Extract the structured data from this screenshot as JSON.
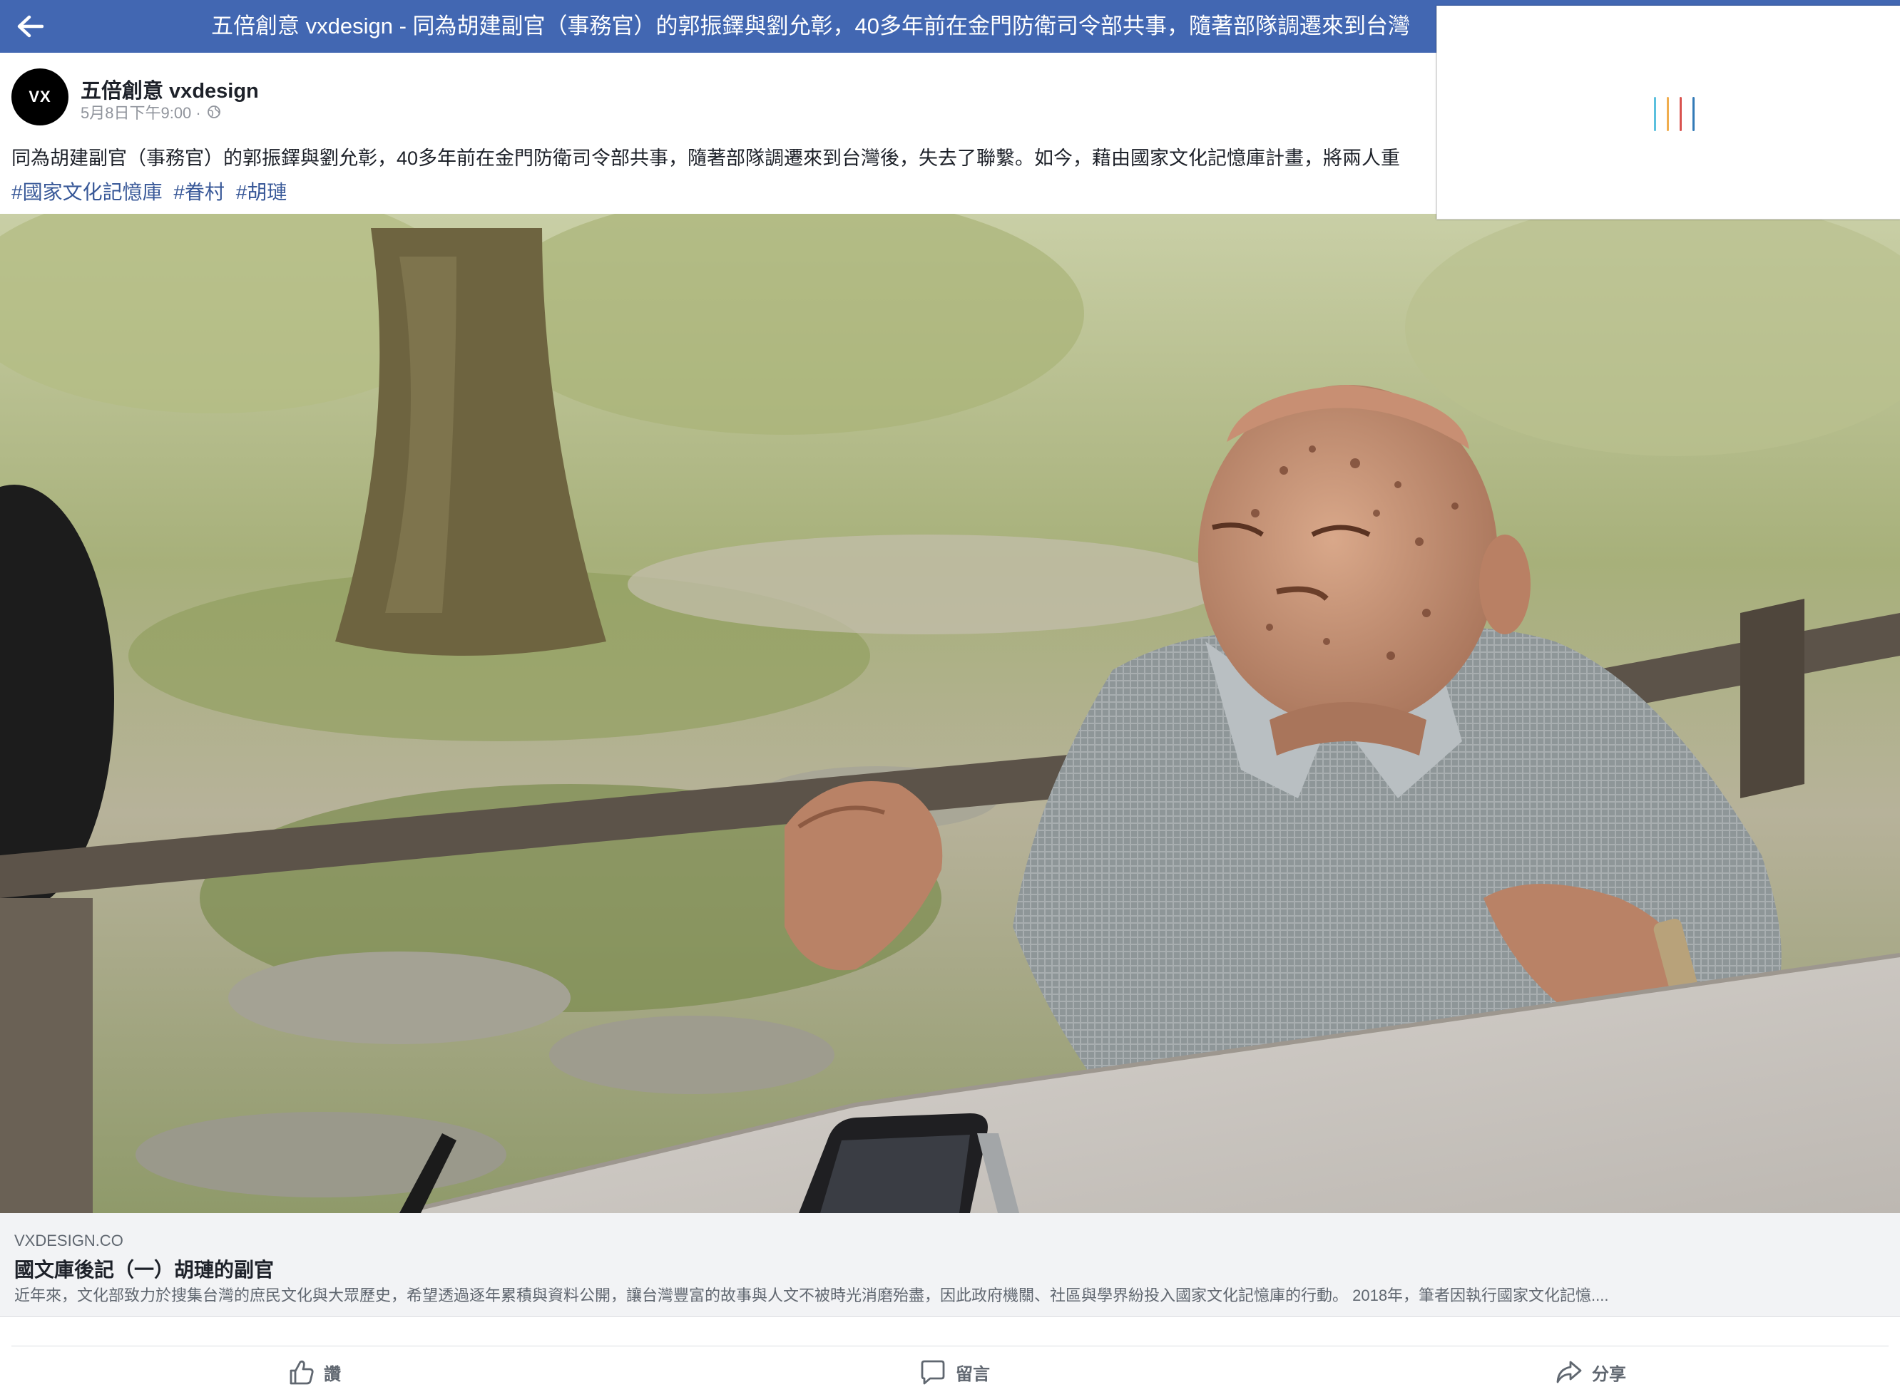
{
  "header": {
    "title": "五倍創意 vxdesign - 同為胡建副官（事務官）的郭振鐸與劉允彰，40多年前在金門防衛司令部共事，隨著部隊調遷來到台灣"
  },
  "post": {
    "avatar_text": "VX",
    "author": "五倍創意 vxdesign",
    "timestamp": "5月8日下午9:00 ·",
    "text": "同為胡建副官（事務官）的郭振鐸與劉允彰，40多年前在金門防衛司令部共事，隨著部隊調遷來到台灣後，失去了聯繫。如今，藉由國家文化記憶庫計畫，將兩人重",
    "hashtags": [
      "#國家文化記憶庫",
      "#眷村",
      "#胡璉"
    ]
  },
  "link_preview": {
    "domain": "VXDESIGN.CO",
    "title": "國文庫後記（一）胡璉的副官",
    "description": "近年來，文化部致力於搜集台灣的庶民文化與大眾歷史，希望透過逐年累積與資料公開，讓台灣豐富的故事與人文不被時光消磨殆盡，因此政府機關、社區與學界紛投入國家文化記憶庫的行動。 2018年，筆者因執行國家文化記憶...."
  },
  "actions": {
    "like": "讚",
    "comment": "留言",
    "share": "分享"
  },
  "colors": {
    "header_bg": "#4267b2",
    "hashtag": "#385898",
    "link_bg": "#f2f3f5",
    "loader": [
      "#5bc0de",
      "#f0ad4e",
      "#d9534f",
      "#337ab7"
    ]
  },
  "icons": {
    "back": "back-arrow-icon",
    "privacy": "globe-icon",
    "like": "thumbs-up-icon",
    "comment": "comment-bubble-icon",
    "share": "share-arrow-icon",
    "loading": "loading-spinner-icon"
  }
}
